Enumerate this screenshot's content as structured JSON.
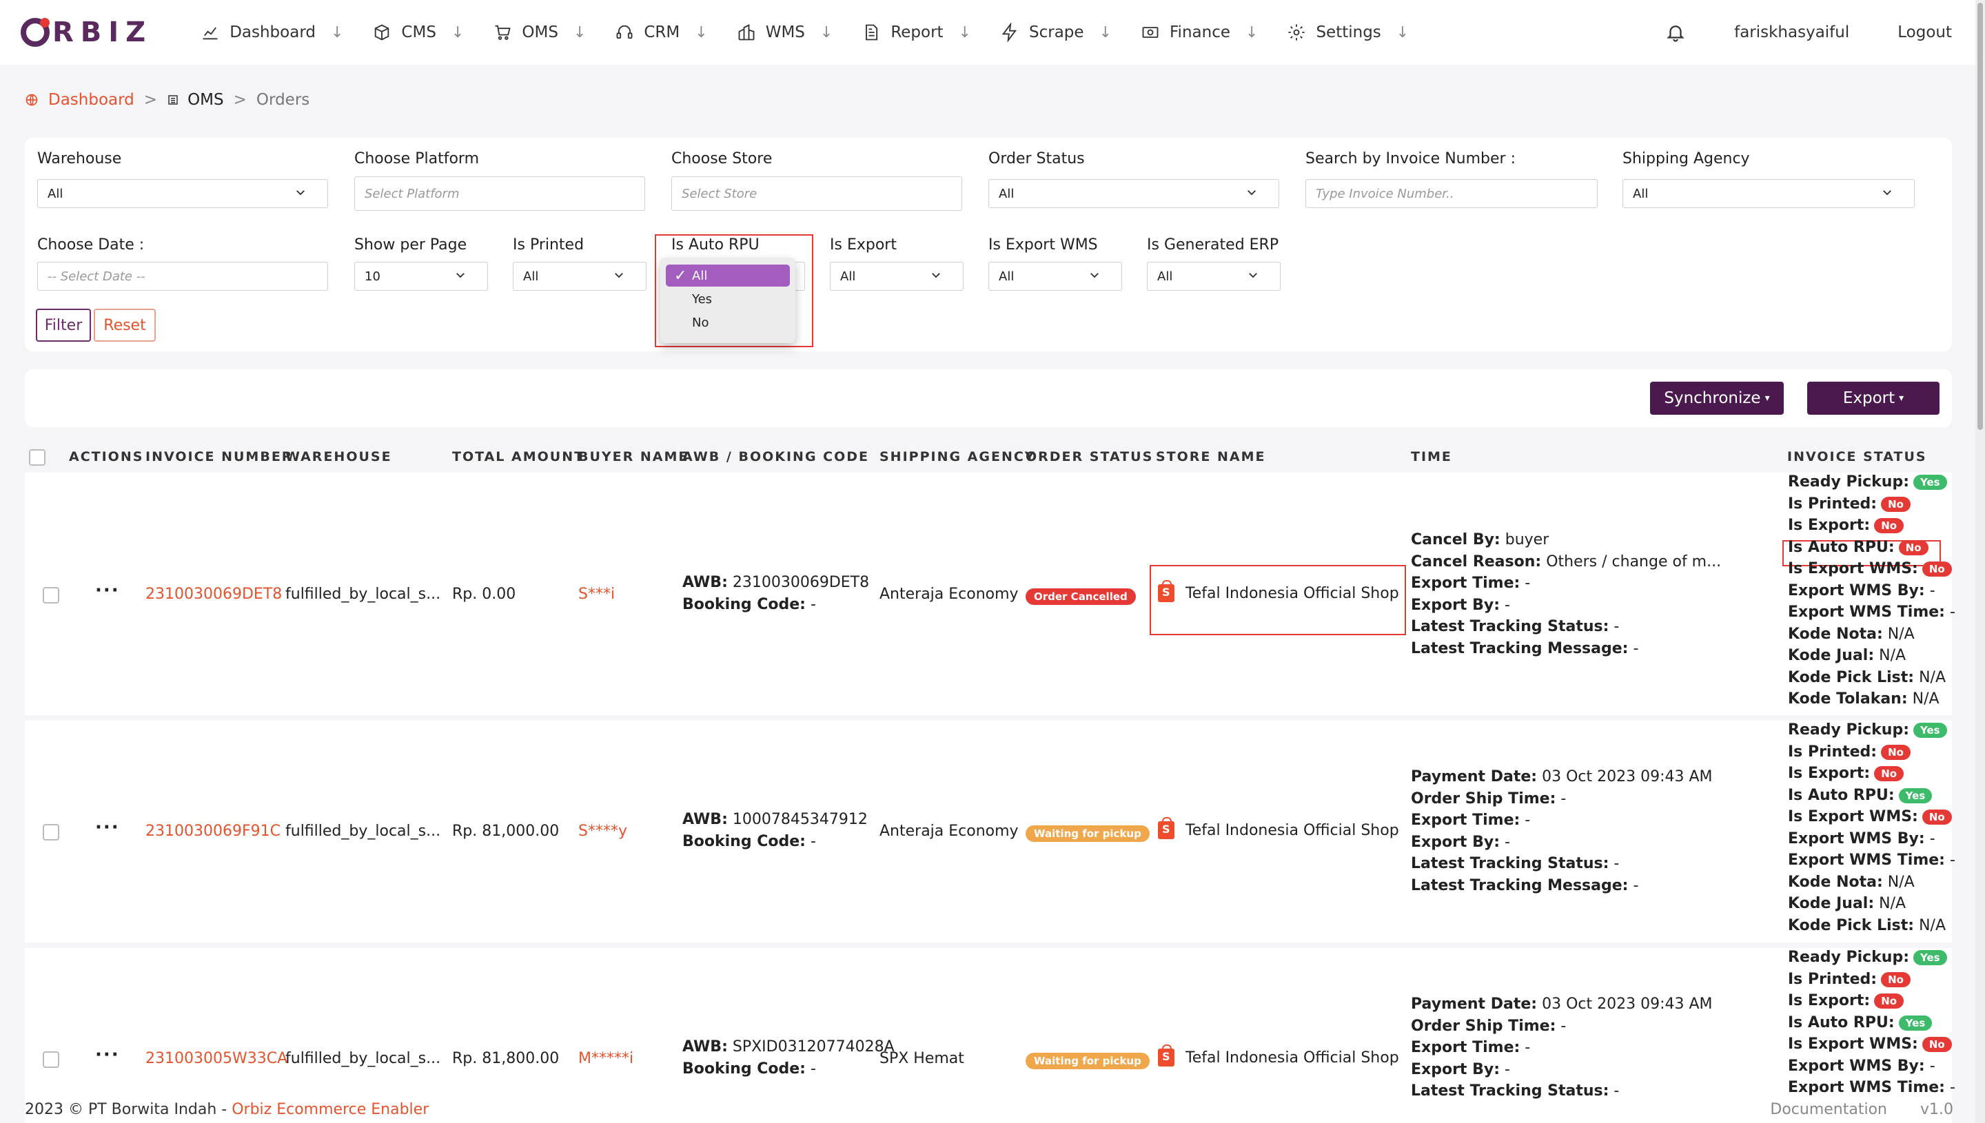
{
  "nav": {
    "logo": "ORBIZ",
    "items": [
      "Dashboard",
      "CMS",
      "OMS",
      "CRM",
      "WMS",
      "Report",
      "Scrape",
      "Finance",
      "Settings"
    ],
    "arrow": "↓",
    "user": "fariskhasyaiful",
    "logout": "Logout"
  },
  "breadcrumb": {
    "home": "Dashboard",
    "oms": "OMS",
    "current": "Orders",
    "sep": ">"
  },
  "filters": {
    "warehouse": {
      "label": "Warehouse",
      "value": "All"
    },
    "platform": {
      "label": "Choose Platform",
      "placeholder": "Select Platform"
    },
    "store": {
      "label": "Choose Store",
      "placeholder": "Select Store"
    },
    "order_status": {
      "label": "Order Status",
      "value": "All"
    },
    "invoice": {
      "label": "Search by Invoice Number :",
      "placeholder": "Type Invoice Number.."
    },
    "shipping": {
      "label": "Shipping Agency",
      "value": "All"
    },
    "date": {
      "label": "Choose Date :",
      "placeholder": "-- Select Date --"
    },
    "per_page": {
      "label": "Show per Page",
      "value": "10"
    },
    "is_printed": {
      "label": "Is Printed",
      "value": "All"
    },
    "is_auto_rpu": {
      "label": "Is Auto RPU",
      "options": [
        "All",
        "Yes",
        "No"
      ],
      "selected": "All"
    },
    "is_export": {
      "label": "Is Export",
      "value": "All"
    },
    "is_export_wms": {
      "label": "Is Export WMS",
      "value": "All"
    },
    "is_generated_erp": {
      "label": "Is Generated ERP",
      "value": "All"
    },
    "filter_btn": "Filter",
    "reset_btn": "Reset"
  },
  "actions": {
    "sync": "Synchronize",
    "export": "Export"
  },
  "table": {
    "headers": [
      "ACTIONS",
      "INVOICE NUMBER",
      "WAREHOUSE",
      "TOTAL AMOUNT",
      "BUYER NAME",
      "AWB / BOOKING CODE",
      "SHIPPING AGENCY",
      "ORDER STATUS",
      "STORE NAME",
      "TIME",
      "INVOICE STATUS"
    ],
    "rows": [
      {
        "invoice": "2310030069DET8",
        "warehouse": "fulfilled_by_local_s...",
        "amount": "Rp. 0.00",
        "buyer": "S***i",
        "awb_label": "AWB:",
        "awb": "2310030069DET8",
        "booking_label": "Booking Code:",
        "booking": "-",
        "shipping": "Anteraja Economy",
        "status": "Order Cancelled",
        "store": "Tefal Indonesia Official Shop",
        "time": [
          {
            "k": "Cancel By:",
            "v": "buyer"
          },
          {
            "k": "Cancel Reason:",
            "v": "Others / change of m..."
          },
          {
            "k": "Export Time:",
            "v": "-"
          },
          {
            "k": "Export By:",
            "v": "-"
          },
          {
            "k": "Latest Tracking Status:",
            "v": "-"
          },
          {
            "k": "Latest Tracking Message:",
            "v": "-"
          }
        ],
        "inv_status": [
          {
            "k": "Ready Pickup:",
            "badge": "Yes"
          },
          {
            "k": "Is Printed:",
            "badge": "No"
          },
          {
            "k": "Is Export:",
            "badge": "No"
          },
          {
            "k": "Is Auto RPU:",
            "badge": "No"
          },
          {
            "k": "Is Export WMS:",
            "badge": "No"
          },
          {
            "k": "Export WMS By:",
            "v": "-"
          },
          {
            "k": "Export WMS Time:",
            "v": "-"
          },
          {
            "k": "Kode Nota:",
            "v": "N/A"
          },
          {
            "k": "Kode Jual:",
            "v": "N/A"
          },
          {
            "k": "Kode Pick List:",
            "v": "N/A"
          },
          {
            "k": "Kode Tolakan:",
            "v": "N/A"
          }
        ]
      },
      {
        "invoice": "2310030069F91C",
        "warehouse": "fulfilled_by_local_s...",
        "amount": "Rp. 81,000.00",
        "buyer": "S****y",
        "awb_label": "AWB:",
        "awb": "10007845347912",
        "booking_label": "Booking Code:",
        "booking": "-",
        "shipping": "Anteraja Economy",
        "status": "Waiting for pickup",
        "store": "Tefal Indonesia Official Shop",
        "time": [
          {
            "k": "Payment Date:",
            "v": "03 Oct 2023 09:43 AM"
          },
          {
            "k": "Order Ship Time:",
            "v": "-"
          },
          {
            "k": "Export Time:",
            "v": "-"
          },
          {
            "k": "Export By:",
            "v": "-"
          },
          {
            "k": "Latest Tracking Status:",
            "v": "-"
          },
          {
            "k": "Latest Tracking Message:",
            "v": "-"
          }
        ],
        "inv_status": [
          {
            "k": "Ready Pickup:",
            "badge": "Yes"
          },
          {
            "k": "Is Printed:",
            "badge": "No"
          },
          {
            "k": "Is Export:",
            "badge": "No"
          },
          {
            "k": "Is Auto RPU:",
            "badge": "Yes"
          },
          {
            "k": "Is Export WMS:",
            "badge": "No"
          },
          {
            "k": "Export WMS By:",
            "v": "-"
          },
          {
            "k": "Export WMS Time:",
            "v": "-"
          },
          {
            "k": "Kode Nota:",
            "v": "N/A"
          },
          {
            "k": "Kode Jual:",
            "v": "N/A"
          },
          {
            "k": "Kode Pick List:",
            "v": "N/A"
          }
        ]
      },
      {
        "invoice": "231003005W33CA",
        "warehouse": "fulfilled_by_local_s...",
        "amount": "Rp. 81,800.00",
        "buyer": "M*****i",
        "awb_label": "AWB:",
        "awb": "SPXID03120774028A",
        "booking_label": "Booking Code:",
        "booking": "-",
        "shipping": "SPX Hemat",
        "status": "Waiting for pickup",
        "store": "Tefal Indonesia Official Shop",
        "time": [
          {
            "k": "Payment Date:",
            "v": "03 Oct 2023 09:43 AM"
          },
          {
            "k": "Order Ship Time:",
            "v": "-"
          },
          {
            "k": "Export Time:",
            "v": "-"
          },
          {
            "k": "Export By:",
            "v": "-"
          },
          {
            "k": "Latest Tracking Status:",
            "v": "-"
          }
        ],
        "inv_status": [
          {
            "k": "Ready Pickup:",
            "badge": "Yes"
          },
          {
            "k": "Is Printed:",
            "badge": "No"
          },
          {
            "k": "Is Export:",
            "badge": "No"
          },
          {
            "k": "Is Auto RPU:",
            "badge": "Yes"
          },
          {
            "k": "Is Export WMS:",
            "badge": "No"
          },
          {
            "k": "Export WMS By:",
            "v": "-"
          },
          {
            "k": "Export WMS Time:",
            "v": "-"
          }
        ]
      }
    ]
  },
  "footer": {
    "copyright": "2023 © PT Borwita Indah - ",
    "brand": "Orbiz Ecommerce Enabler",
    "docs": "Documentation",
    "version": "v1.0"
  },
  "colors": {
    "brand": "#5a2a5e",
    "accent": "#e5532e",
    "yes": "#3dbb6a",
    "no": "#e53935"
  }
}
